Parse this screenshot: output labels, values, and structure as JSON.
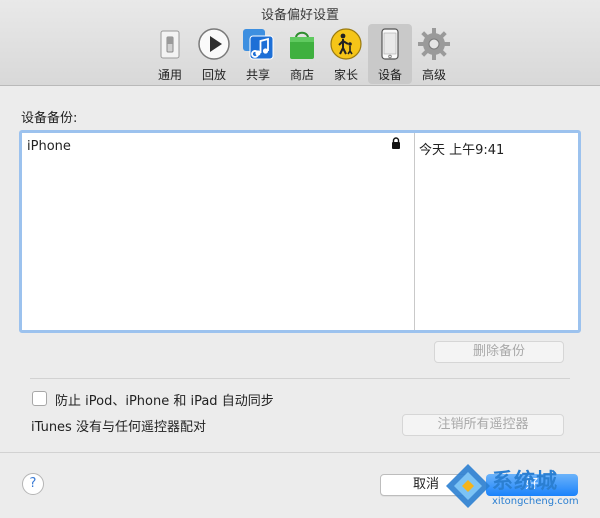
{
  "window": {
    "title": "设备偏好设置"
  },
  "toolbar": {
    "items": [
      {
        "label": "通用",
        "icon": "general-switch-icon"
      },
      {
        "label": "回放",
        "icon": "play-icon"
      },
      {
        "label": "共享",
        "icon": "music-note-icon"
      },
      {
        "label": "商店",
        "icon": "shopping-bag-icon"
      },
      {
        "label": "家长",
        "icon": "parental-icon"
      },
      {
        "label": "设备",
        "icon": "iphone-icon",
        "active": true
      },
      {
        "label": "高级",
        "icon": "gear-icon"
      }
    ]
  },
  "backups": {
    "section_label": "设备备份:",
    "rows": [
      {
        "device": "iPhone",
        "locked": true,
        "time": "今天 上午9:41"
      }
    ],
    "delete_button": "删除备份"
  },
  "sync": {
    "prevent_label": "防止 iPod、iPhone 和 iPad 自动同步",
    "remote_status": "iTunes 没有与任何遥控器配对",
    "deauth_button": "注销所有遥控器"
  },
  "footer": {
    "help": "?",
    "cancel": "取消",
    "ok": "好"
  },
  "watermark": {
    "brand": "系统城",
    "url": "xitongcheng.com"
  },
  "colors": {
    "accent": "#1a82fb",
    "selection_border": "#9cc2ee",
    "watermark": "#2b7fd1"
  }
}
